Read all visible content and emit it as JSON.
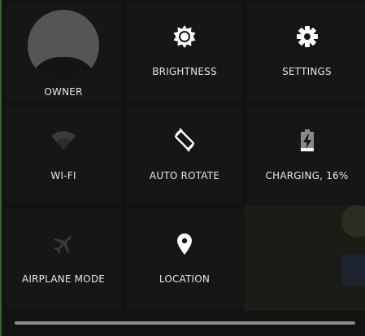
{
  "tiles": {
    "owner": {
      "label": "OWNER",
      "icon": "avatar"
    },
    "brightness": {
      "label": "BRIGHTNESS",
      "icon": "brightness-icon"
    },
    "settings": {
      "label": "SETTINGS",
      "icon": "gear-icon"
    },
    "wifi": {
      "label": "WI-FI",
      "icon": "wifi-icon"
    },
    "auto_rotate": {
      "label": "AUTO ROTATE",
      "icon": "rotate-icon"
    },
    "battery": {
      "label": "CHARGING, 16%",
      "icon": "battery-charging-icon",
      "level_percent": 16
    },
    "airplane": {
      "label": "AIRPLANE MODE",
      "icon": "airplane-icon"
    },
    "location": {
      "label": "LOCATION",
      "icon": "location-pin-icon"
    }
  },
  "colors": {
    "tile_bg": "#161616",
    "text": "#e6e6e6",
    "icon_on": "#ffffff",
    "icon_off": "#3a3a3a",
    "accent_edge": "#2c6b24"
  }
}
